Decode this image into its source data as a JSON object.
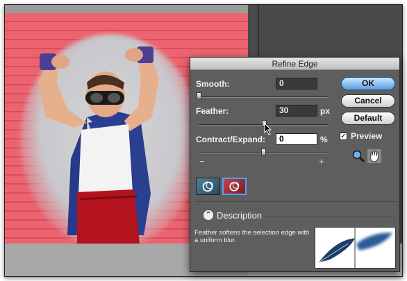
{
  "dialog": {
    "title": "Refine Edge",
    "smooth": {
      "label": "Smooth:",
      "value": "0"
    },
    "feather": {
      "label": "Feather:",
      "value": "30",
      "unit": "px"
    },
    "contract_expand": {
      "label": "Contract/Expand:",
      "value": "0",
      "unit": "%",
      "minus": "−",
      "plus": "+"
    },
    "buttons": {
      "ok": "OK",
      "cancel": "Cancel",
      "default": "Default"
    },
    "preview": {
      "label": "Preview",
      "checked": true
    },
    "description": {
      "heading": "Description",
      "text": "Feather softens the selection edge with a uniform blur."
    }
  },
  "icons": [
    "zoom-icon",
    "hand-icon",
    "standard-mode-icon",
    "quick-mask-mode-icon",
    "expand-collapse-icon",
    "feather-preview-image"
  ],
  "colors": {
    "accent": "#4aa3ff",
    "dialog_bg": "#5e5e5e",
    "ok_blue": "#5b9ee6"
  }
}
